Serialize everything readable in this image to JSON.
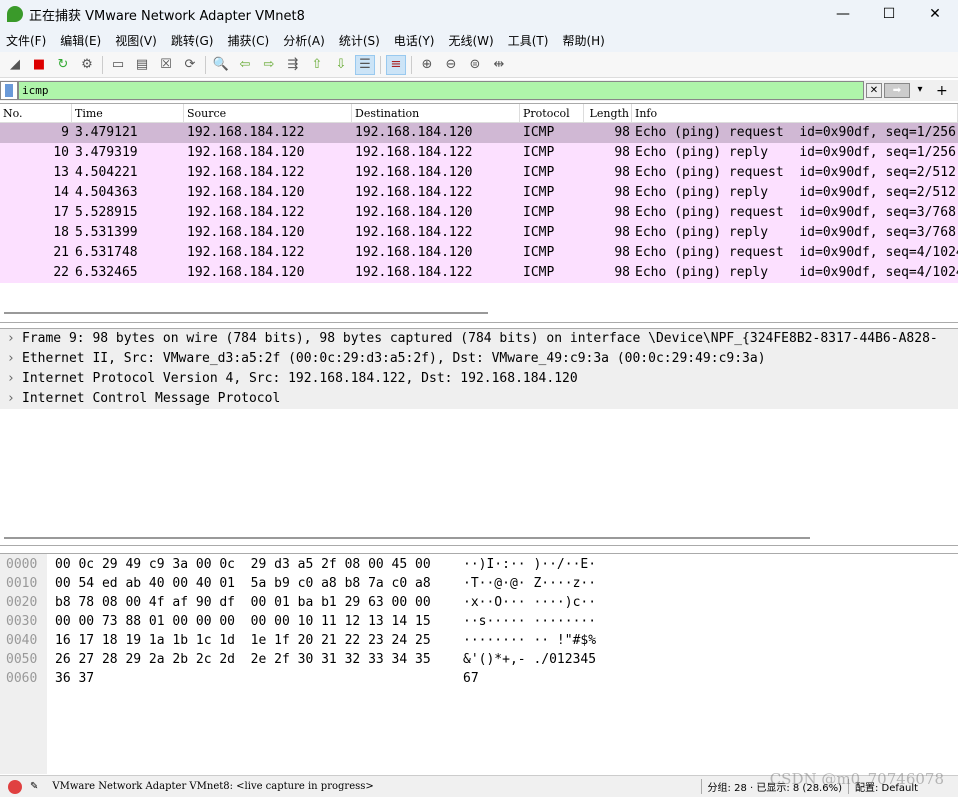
{
  "window": {
    "title": "正在捕获 VMware Network Adapter VMnet8",
    "minimize": "—",
    "maximize": "☐",
    "close": "✕"
  },
  "menu": [
    "文件(F)",
    "编辑(E)",
    "视图(V)",
    "跳转(G)",
    "捕获(C)",
    "分析(A)",
    "统计(S)",
    "电话(Y)",
    "无线(W)",
    "工具(T)",
    "帮助(H)"
  ],
  "toolbar": [
    "shark-fin-start-icon",
    "stop-icon",
    "restart-icon",
    "options-gear-icon",
    "|",
    "open-icon",
    "save-icon",
    "close-file-icon",
    "reload-icon",
    "|",
    "find-icon",
    "back-icon",
    "forward-icon",
    "goto-icon",
    "first-icon",
    "last-icon",
    "autoscroll-icon",
    "|",
    "colorize-icon",
    "|",
    "zoom-in-icon",
    "zoom-out-icon",
    "zoom-normal-icon",
    "resize-columns-icon"
  ],
  "filter": {
    "value": "icmp"
  },
  "columns": [
    "No.",
    "Time",
    "Source",
    "Destination",
    "Protocol",
    "Length",
    "Info"
  ],
  "packets": [
    [
      "9",
      "3.479121",
      "192.168.184.122",
      "192.168.184.120",
      "ICMP",
      "98",
      "Echo (ping) request  id=0x90df, seq=1/256"
    ],
    [
      "10",
      "3.479319",
      "192.168.184.120",
      "192.168.184.122",
      "ICMP",
      "98",
      "Echo (ping) reply    id=0x90df, seq=1/256"
    ],
    [
      "13",
      "4.504221",
      "192.168.184.122",
      "192.168.184.120",
      "ICMP",
      "98",
      "Echo (ping) request  id=0x90df, seq=2/512"
    ],
    [
      "14",
      "4.504363",
      "192.168.184.120",
      "192.168.184.122",
      "ICMP",
      "98",
      "Echo (ping) reply    id=0x90df, seq=2/512"
    ],
    [
      "17",
      "5.528915",
      "192.168.184.122",
      "192.168.184.120",
      "ICMP",
      "98",
      "Echo (ping) request  id=0x90df, seq=3/768"
    ],
    [
      "18",
      "5.531399",
      "192.168.184.120",
      "192.168.184.122",
      "ICMP",
      "98",
      "Echo (ping) reply    id=0x90df, seq=3/768"
    ],
    [
      "21",
      "6.531748",
      "192.168.184.122",
      "192.168.184.120",
      "ICMP",
      "98",
      "Echo (ping) request  id=0x90df, seq=4/1024"
    ],
    [
      "22",
      "6.532465",
      "192.168.184.120",
      "192.168.184.122",
      "ICMP",
      "98",
      "Echo (ping) reply    id=0x90df, seq=4/1024"
    ]
  ],
  "details": [
    "Frame 9: 98 bytes on wire (784 bits), 98 bytes captured (784 bits) on interface \\Device\\NPF_{324FE8B2-8317-44B6-A828-",
    "Ethernet II, Src: VMware_d3:a5:2f (00:0c:29:d3:a5:2f), Dst: VMware_49:c9:3a (00:0c:29:49:c9:3a)",
    "Internet Protocol Version 4, Src: 192.168.184.122, Dst: 192.168.184.120",
    "Internet Control Message Protocol"
  ],
  "hex": [
    [
      "0000",
      "00 0c 29 49 c9 3a 00 0c  29 d3 a5 2f 08 00 45 00",
      "··)I·:·· )··/··E·"
    ],
    [
      "0010",
      "00 54 ed ab 40 00 40 01  5a b9 c0 a8 b8 7a c0 a8",
      "·T··@·@· Z····z··"
    ],
    [
      "0020",
      "b8 78 08 00 4f af 90 df  00 01 ba b1 29 63 00 00",
      "·x··O··· ····)c··"
    ],
    [
      "0030",
      "00 00 73 88 01 00 00 00  00 00 10 11 12 13 14 15",
      "··s····· ········"
    ],
    [
      "0040",
      "16 17 18 19 1a 1b 1c 1d  1e 1f 20 21 22 23 24 25",
      "········ ·· !\"#$%"
    ],
    [
      "0050",
      "26 27 28 29 2a 2b 2c 2d  2e 2f 30 31 32 33 34 35",
      "&'()*+,- ./012345"
    ],
    [
      "0060",
      "36 37",
      "67"
    ]
  ],
  "status": {
    "text": "VMware Network Adapter VMnet8: <live capture in progress>",
    "packets": "分组: 28 · 已显示: 8 (28.6%)",
    "profile": "配置: Default",
    "watermark": "CSDN @m0_70746078"
  }
}
